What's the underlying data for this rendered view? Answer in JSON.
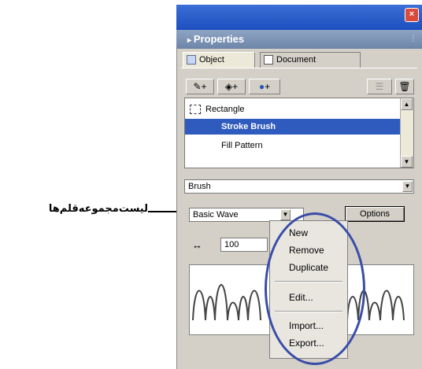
{
  "annotation": {
    "label": "لیست‌مجموعه‌قلم‌ها"
  },
  "panel": {
    "title": "Properties",
    "tabs": [
      {
        "label": "Object",
        "active": true
      },
      {
        "label": "Document",
        "active": false
      }
    ],
    "toolbar": {
      "add_stroke": "+",
      "add_fill": "+",
      "add_effect": "+"
    },
    "object_list": [
      {
        "label": "Rectangle",
        "selected": false
      },
      {
        "label": "Stroke Brush",
        "selected": true
      },
      {
        "label": "Fill Pattern",
        "selected": false
      }
    ],
    "stroke_type": "Brush",
    "brush_library": "Basic Wave",
    "options_button": "Options",
    "size_value": "100"
  },
  "context_menu": {
    "items": [
      "New",
      "Remove",
      "Duplicate",
      "Edit...",
      "Import...",
      "Export..."
    ]
  },
  "colors": {
    "selection": "#2f5bbf",
    "annotation_ellipse": "#3a4da8"
  }
}
